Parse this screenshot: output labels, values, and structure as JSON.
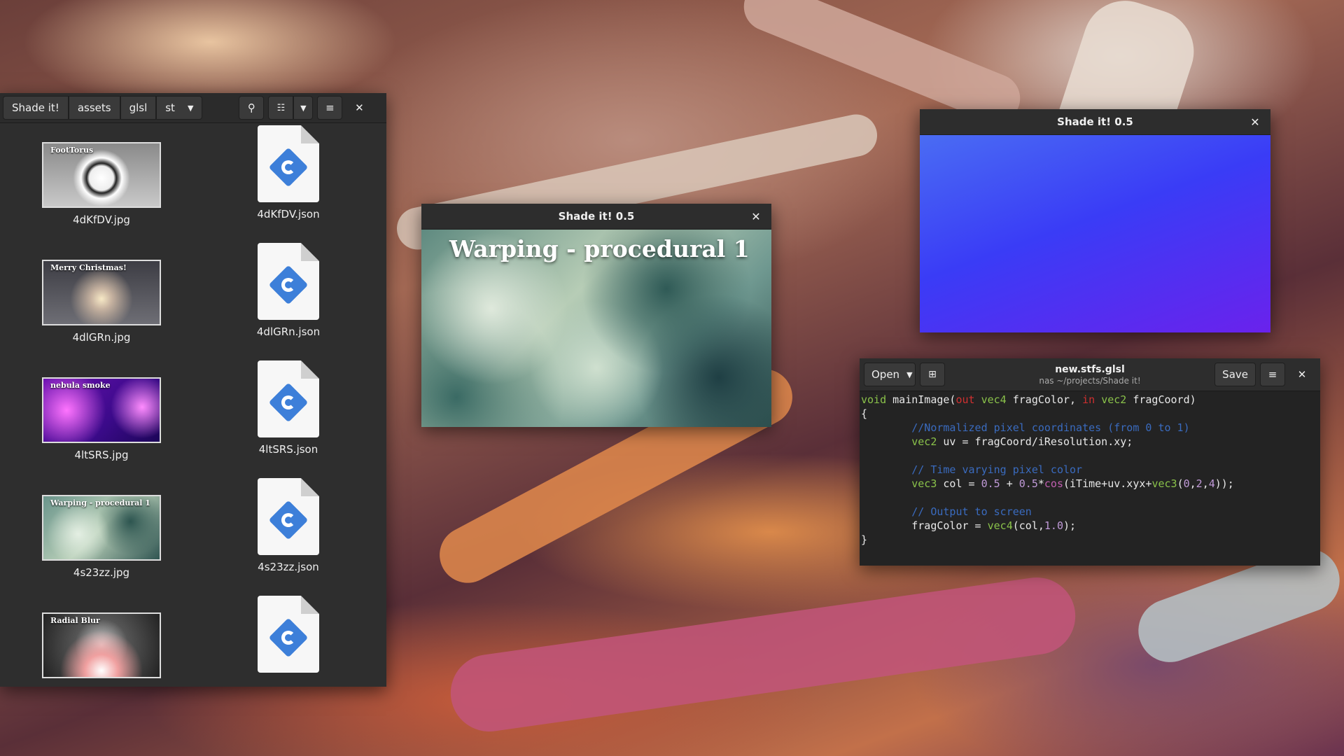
{
  "file_manager": {
    "breadcrumbs": [
      "Shade it!",
      "assets",
      "glsl",
      "st"
    ],
    "items": [
      {
        "kind": "image",
        "name": "4dKfDV.jpg",
        "thumb_label": "FootTorus"
      },
      {
        "kind": "doc",
        "name": "4dKfDV.json"
      },
      {
        "kind": "image",
        "name": "4dlGRn.jpg",
        "thumb_label": "Merry Christmas!"
      },
      {
        "kind": "doc",
        "name": "4dlGRn.json"
      },
      {
        "kind": "image",
        "name": "4ltSRS.jpg",
        "thumb_label": "nebula smoke"
      },
      {
        "kind": "doc",
        "name": "4ltSRS.json"
      },
      {
        "kind": "image",
        "name": "4s23zz.jpg",
        "thumb_label": "Warping - procedural 1"
      },
      {
        "kind": "doc",
        "name": "4s23zz.json"
      },
      {
        "kind": "image",
        "name": "",
        "thumb_label": "Radial Blur"
      },
      {
        "kind": "doc",
        "name": ""
      }
    ]
  },
  "preview_window": {
    "title": "Shade it! 0.5",
    "heading": "Warping - procedural 1"
  },
  "gradient_window": {
    "title": "Shade it! 0.5"
  },
  "editor": {
    "open_label": "Open",
    "title": "new.stfs.glsl",
    "subtitle": "nas ~/projects/Shade it!",
    "save_label": "Save",
    "code_lines": [
      "void mainImage(out vec4 fragColor, in vec2 fragCoord)",
      "{",
      "        //Normalized pixel coordinates (from 0 to 1)",
      "        vec2 uv = fragCoord/iResolution.xy;",
      "",
      "        // Time varying pixel color",
      "        vec3 col = 0.5 + 0.5*cos(iTime+uv.xyx+vec3(0,2,4));",
      "",
      "        // Output to screen",
      "        fragColor = vec4(col,1.0);",
      "}"
    ]
  },
  "colors": {
    "accent_blue": "#3d7fd9",
    "keyword_green": "#8ac24a",
    "comment_blue": "#3a6bbf"
  }
}
